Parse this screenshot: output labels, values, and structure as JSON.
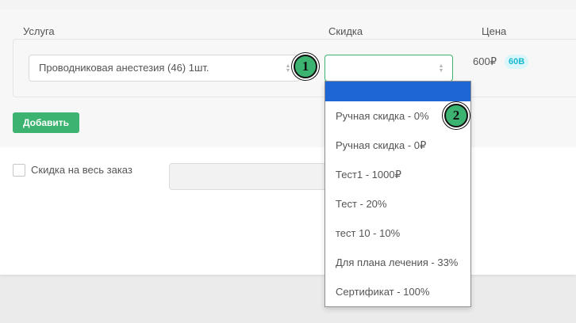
{
  "header": {
    "service": "Услуга",
    "discount": "Скидка",
    "price": "Цена"
  },
  "row": {
    "service_value": "Проводниковая анестезия (46) 1шт.",
    "discount_value": "",
    "price": "600₽",
    "badge": "60В"
  },
  "add_button": "Добавить",
  "order_discount_label": "Скидка на весь заказ",
  "dropdown": {
    "selected_index": 0,
    "options": [
      "",
      "Ручная скидка - 0%",
      "Ручная скидка - 0₽",
      "Тест1 - 1000₽",
      "Тест - 20%",
      "тест 10 - 10%",
      "Для плана лечения - 33%",
      "Сертификат - 100%"
    ]
  },
  "markers": [
    "1",
    "2"
  ],
  "colors": {
    "accent_green": "#3cb371",
    "select_highlight": "#1e66d6",
    "badge_text": "#19b8cf",
    "badge_bg": "#d9f7fb"
  }
}
